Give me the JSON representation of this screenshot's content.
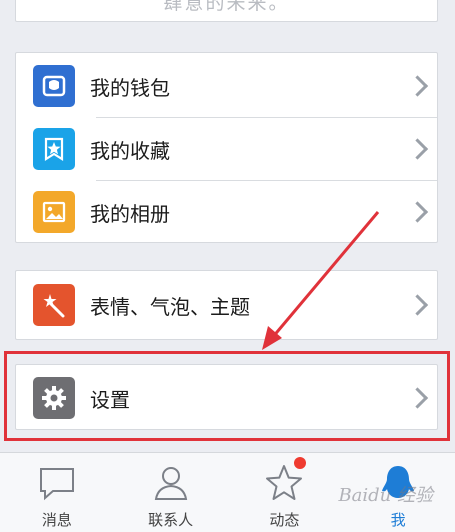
{
  "top_card": {
    "text": "肆意的未来。"
  },
  "menu_group_1": [
    {
      "label": "我的钱包",
      "icon": "wallet-icon",
      "color": "#2f6fd1"
    },
    {
      "label": "我的收藏",
      "icon": "favorites-icon",
      "color": "#1aa3e8"
    },
    {
      "label": "我的相册",
      "icon": "album-icon",
      "color": "#f3a82a"
    }
  ],
  "menu_group_2": [
    {
      "label": "表情、气泡、主题",
      "icon": "sticker-theme-icon",
      "color": "#e4542d"
    }
  ],
  "menu_group_3": [
    {
      "label": "设置",
      "icon": "settings-gear-icon",
      "color": "#6e6e72"
    }
  ],
  "annotation": {
    "color": "#e0323a"
  },
  "tabbar": {
    "tabs": [
      {
        "label": "消息",
        "icon": "message-bubble-icon"
      },
      {
        "label": "联系人",
        "icon": "contacts-icon"
      },
      {
        "label": "动态",
        "icon": "star-icon",
        "has_badge": true
      },
      {
        "label": "我",
        "icon": "me-penguin-icon",
        "active": true
      }
    ],
    "active_color": "#1e7dd6",
    "badge_color": "#ef3b30"
  }
}
